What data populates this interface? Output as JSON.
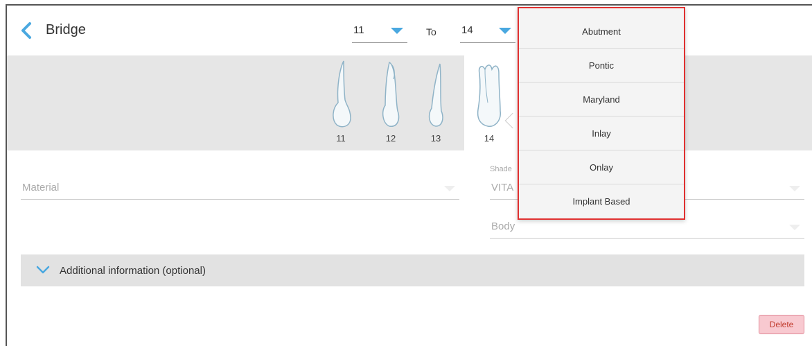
{
  "header": {
    "title": "Bridge",
    "from_value": "11",
    "to_label": "To",
    "to_value": "14"
  },
  "teeth": [
    {
      "number": "11"
    },
    {
      "number": "12"
    },
    {
      "number": "13"
    },
    {
      "number": "14"
    }
  ],
  "form": {
    "material_placeholder": "Material",
    "shade_label": "Shade",
    "shade_value": "VITA",
    "body_placeholder": "Body",
    "additional_info": "Additional information (optional)",
    "delete_label": "Delete"
  },
  "dropdown": {
    "items": [
      "Abutment",
      "Pontic",
      "Maryland",
      "Inlay",
      "Onlay",
      "Implant Based"
    ]
  },
  "colors": {
    "accent": "#4aa8e0",
    "highlight_border": "#e03030",
    "delete_bg": "#f8c9d0"
  }
}
